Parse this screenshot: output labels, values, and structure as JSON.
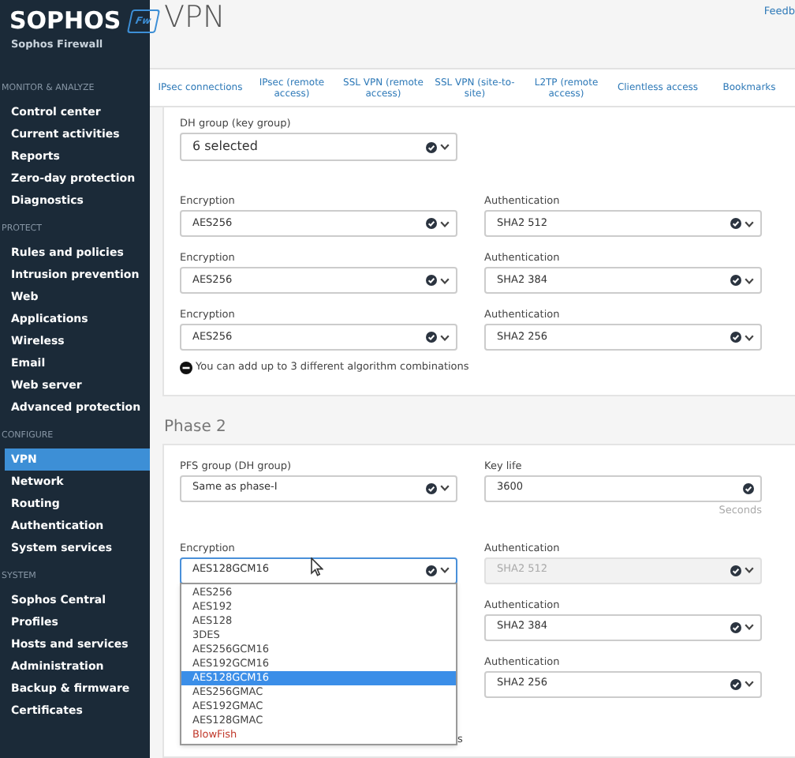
{
  "sidebar": {
    "logo": "SOPHOS",
    "badge": "Fw",
    "product": "Sophos Firewall",
    "sections": [
      {
        "title": "MONITOR & ANALYZE",
        "items": [
          {
            "label": "Control center",
            "selected": false
          },
          {
            "label": "Current activities",
            "selected": false
          },
          {
            "label": "Reports",
            "selected": false
          },
          {
            "label": "Zero-day protection",
            "selected": false
          },
          {
            "label": "Diagnostics",
            "selected": false
          }
        ]
      },
      {
        "title": "PROTECT",
        "items": [
          {
            "label": "Rules and policies",
            "selected": false
          },
          {
            "label": "Intrusion prevention",
            "selected": false
          },
          {
            "label": "Web",
            "selected": false
          },
          {
            "label": "Applications",
            "selected": false
          },
          {
            "label": "Wireless",
            "selected": false
          },
          {
            "label": "Email",
            "selected": false
          },
          {
            "label": "Web server",
            "selected": false
          },
          {
            "label": "Advanced protection",
            "selected": false
          }
        ]
      },
      {
        "title": "CONFIGURE",
        "items": [
          {
            "label": "VPN",
            "selected": true
          },
          {
            "label": "Network",
            "selected": false
          },
          {
            "label": "Routing",
            "selected": false
          },
          {
            "label": "Authentication",
            "selected": false
          },
          {
            "label": "System services",
            "selected": false
          }
        ]
      },
      {
        "title": "SYSTEM",
        "items": [
          {
            "label": "Sophos Central",
            "selected": false
          },
          {
            "label": "Profiles",
            "selected": false
          },
          {
            "label": "Hosts and services",
            "selected": false
          },
          {
            "label": "Administration",
            "selected": false
          },
          {
            "label": "Backup & firmware",
            "selected": false
          },
          {
            "label": "Certificates",
            "selected": false
          }
        ]
      }
    ]
  },
  "page_title": "VPN",
  "feedback_link": "Feedb",
  "tabs": [
    {
      "label": "IPsec connections",
      "selected": false
    },
    {
      "label": "IPsec (remote access)",
      "selected": false
    },
    {
      "label": "SSL VPN (remote access)",
      "selected": false
    },
    {
      "label": "SSL VPN (site-to-site)",
      "selected": false
    },
    {
      "label": "L2TP (remote access)",
      "selected": false
    },
    {
      "label": "Clientless access",
      "selected": false
    },
    {
      "label": "Bookmarks",
      "selected": false
    }
  ],
  "phase1": {
    "dh_group": {
      "label": "DH group (key group)",
      "value": "6 selected"
    },
    "rows": [
      {
        "encryption_label": "Encryption",
        "encryption": "AES256",
        "authentication_label": "Authentication",
        "authentication": "SHA2 512"
      },
      {
        "encryption_label": "Encryption",
        "encryption": "AES256",
        "authentication_label": "Authentication",
        "authentication": "SHA2 384"
      },
      {
        "encryption_label": "Encryption",
        "encryption": "AES256",
        "authentication_label": "Authentication",
        "authentication": "SHA2 256"
      }
    ],
    "hint": "You can add up to 3 different algorithm combinations"
  },
  "phase2": {
    "title": "Phase 2",
    "pfs_group": {
      "label": "PFS group (DH group)",
      "value": "Same as phase-I"
    },
    "key_life": {
      "label": "Key life",
      "value": "3600",
      "unit": "Seconds"
    },
    "rows": [
      {
        "encryption_label": "Encryption",
        "encryption": "AES128GCM16",
        "authentication_label": "Authentication",
        "authentication": "SHA2 512",
        "disabled": true
      },
      {
        "authentication_label": "Authentication",
        "authentication": "SHA2 384",
        "disabled": false
      },
      {
        "authentication_label": "Authentication",
        "authentication": "SHA2 256",
        "disabled": false
      }
    ],
    "hint_tail": "s",
    "dropdown": [
      {
        "label": "AES256",
        "selected": false,
        "warning": false
      },
      {
        "label": "AES192",
        "selected": false,
        "warning": false
      },
      {
        "label": "AES128",
        "selected": false,
        "warning": false
      },
      {
        "label": "3DES",
        "selected": false,
        "warning": false
      },
      {
        "label": "AES256GCM16",
        "selected": false,
        "warning": false
      },
      {
        "label": "AES192GCM16",
        "selected": false,
        "warning": false
      },
      {
        "label": "AES128GCM16",
        "selected": true,
        "warning": false
      },
      {
        "label": "AES256GMAC",
        "selected": false,
        "warning": false
      },
      {
        "label": "AES192GMAC",
        "selected": false,
        "warning": false
      },
      {
        "label": "AES128GMAC",
        "selected": false,
        "warning": false
      },
      {
        "label": "BlowFish",
        "selected": false,
        "warning": true
      }
    ]
  }
}
